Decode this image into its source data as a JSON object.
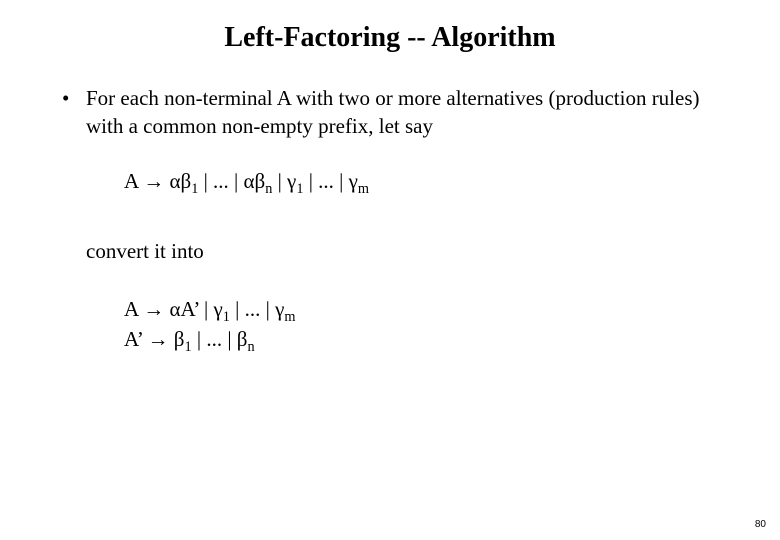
{
  "title": "Left-Factoring -- Algorithm",
  "bullet": "For each non-terminal A with two or more alternatives (production rules) with a common non-empty prefix, let say",
  "formula1_html": "A → αβ<sub>1</sub> | ... | αβ<sub>n</sub> |  γ<sub>1</sub> | ... | γ<sub>m</sub>",
  "convert": "convert it into",
  "formula2a_html": "A → αA’ |  γ<sub>1</sub> | ... | γ<sub>m</sub>",
  "formula2b_html": "A’ → β<sub>1</sub> | ... | β<sub>n</sub>",
  "page_number": "80"
}
